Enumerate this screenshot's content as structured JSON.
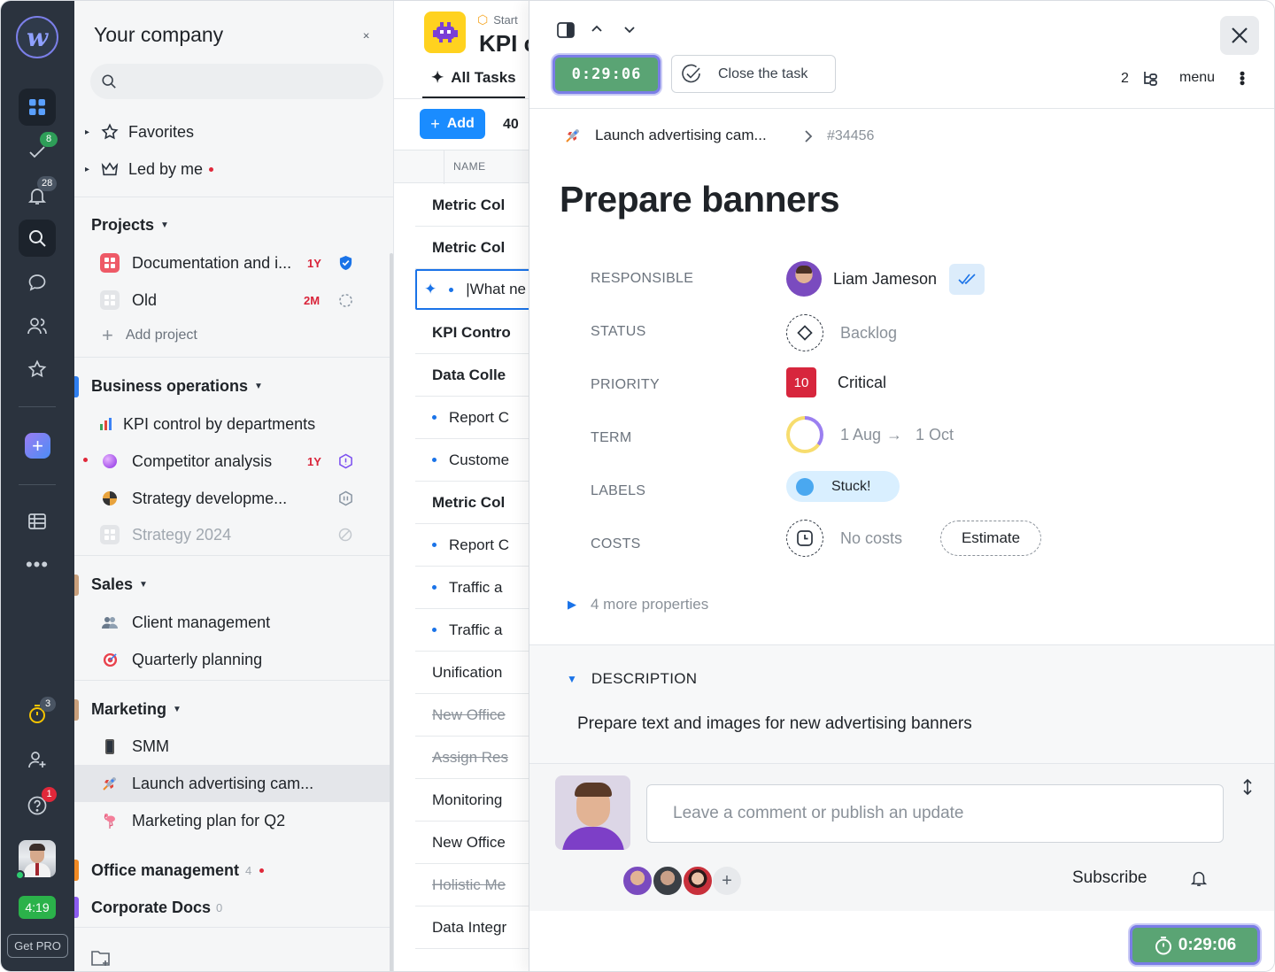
{
  "rail": {
    "logo_letter": "w",
    "tasks_badge": "8",
    "notifications_badge": "28",
    "timer_badge": "3",
    "help_badge": "1",
    "time_label": "4:19",
    "get_pro": "Get PRO",
    "accent_color": "#7b7fe8"
  },
  "sidebar": {
    "title": "Your company",
    "collapse_label": "›‹",
    "favorites": "Favorites",
    "led_by_me": "Led by me",
    "projects_heading": "Projects",
    "projects": [
      {
        "label": "Documentation and i...",
        "tag": "1Y"
      },
      {
        "label": "Old",
        "tag": "2M"
      }
    ],
    "add_project": "Add project",
    "business_heading": "Business operations",
    "business": [
      {
        "label": "KPI control by departments"
      },
      {
        "label": "Competitor analysis",
        "tag": "1Y"
      },
      {
        "label": "Strategy developme..."
      },
      {
        "label": "Strategy 2024"
      }
    ],
    "sales_heading": "Sales",
    "sales": [
      {
        "label": "Client management"
      },
      {
        "label": "Quarterly planning"
      }
    ],
    "marketing_heading": "Marketing",
    "marketing": [
      {
        "label": "SMM"
      },
      {
        "label": "Launch advertising cam..."
      },
      {
        "label": "Marketing plan for Q2"
      }
    ],
    "office_heading": "Office management",
    "office_count": "4",
    "docs_heading": "Corporate Docs",
    "docs_count": "0"
  },
  "list": {
    "breadcrumb": "Start",
    "title": "KPI c",
    "tab_all": "All Tasks",
    "add_button": "Add",
    "count": "40",
    "col_name": "NAME",
    "rows": [
      {
        "label": "Metric Col",
        "bold": true
      },
      {
        "label": "Metric Col",
        "bold": true
      },
      {
        "label": "|What ne",
        "editing": true
      },
      {
        "label": "KPI Contro",
        "bold": true
      },
      {
        "label": "Data Colle",
        "bold": true
      },
      {
        "label": "Report C",
        "bullet": true
      },
      {
        "label": "Custome",
        "bullet": true
      },
      {
        "label": "Metric Col",
        "bold": true
      },
      {
        "label": "Report C",
        "bullet": true
      },
      {
        "label": "Traffic a",
        "bullet": true
      },
      {
        "label": "Traffic a",
        "bullet": true
      },
      {
        "label": "Unification"
      },
      {
        "label": "New Office",
        "done": true
      },
      {
        "label": "Assign Res",
        "done": true
      },
      {
        "label": "Monitoring"
      },
      {
        "label": "New Office"
      },
      {
        "label": "Holistic Me",
        "done": true
      },
      {
        "label": "Data Integr"
      }
    ]
  },
  "panel": {
    "timer": "0:29:06",
    "close_task": "Close the task",
    "subtasks_count": "2",
    "menu": "menu",
    "parent": "Launch advertising cam...",
    "task_id": "#34456",
    "title": "Prepare banners",
    "labels": {
      "responsible": "RESPONSIBLE",
      "status": "STATUS",
      "priority": "PRIORITY",
      "term": "TERM",
      "labels": "LABELS",
      "costs": "COSTS"
    },
    "responsible": "Liam Jameson",
    "status": "Backlog",
    "priority_num": "10",
    "priority": "Critical",
    "term_start": "1 Aug",
    "term_arrow": "→",
    "term_end": "1 Oct",
    "label": "Stuck!",
    "costs": "No costs",
    "estimate": "Estimate",
    "more_props": "4 more properties",
    "description_heading": "DESCRIPTION",
    "description": "Prepare text and images for new advertising banners",
    "comment_placeholder": "Leave a comment or publish an update",
    "subscribe": "Subscribe",
    "timer_bottom": "0:29:06",
    "colors": {
      "timer": "#5aa474",
      "priority": "#d7263d",
      "label": "#d9efff",
      "link": "#1a73e8"
    }
  }
}
